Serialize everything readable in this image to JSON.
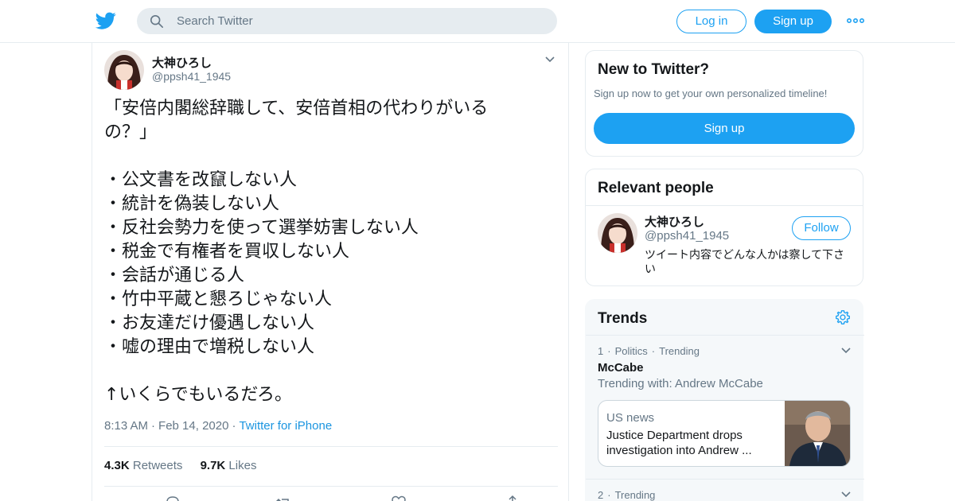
{
  "header": {
    "search_placeholder": "Search Twitter",
    "login_label": "Log in",
    "signup_label": "Sign up",
    "brand_color": "#1da1f2"
  },
  "tweet": {
    "author_name": "大神ひろし",
    "author_handle": "@ppsh41_1945",
    "lines": [
      "「安倍内閣総辞職して、安倍首相の代わりがいる",
      "の？」",
      "",
      "・公文書を改竄しない人",
      "・統計を偽装しない人",
      "・反社会勢力を使って選挙妨害しない人",
      "・税金で有権者を買収しない人",
      "・会話が通じる人",
      "・竹中平蔵と懇ろじゃない人",
      "・お友達だけ優遇しない人",
      "・嘘の理由で増税しない人",
      "",
      "↑いくらでもいるだろ。"
    ],
    "time": "8:13 AM",
    "date": "Feb 14, 2020",
    "source": "Twitter for iPhone",
    "retweets_count": "4.3K",
    "retweets_label": "Retweets",
    "likes_count": "9.7K",
    "likes_label": "Likes"
  },
  "sidebar": {
    "new_to_twitter": {
      "title": "New to Twitter?",
      "subtitle": "Sign up now to get your own personalized timeline!",
      "button": "Sign up"
    },
    "relevant_people": {
      "title": "Relevant people",
      "name": "大神ひろし",
      "handle": "@ppsh41_1945",
      "bio": "ツイート内容でどんな人かは察して下さい",
      "follow_label": "Follow"
    },
    "trends": {
      "title": "Trends",
      "items": [
        {
          "rank": "1",
          "category": "Politics",
          "status": "Trending",
          "name": "McCabe",
          "with": "Trending with: Andrew McCabe",
          "news_source": "US news",
          "news_headline": "Justice Department drops investigation into Andrew ..."
        },
        {
          "rank": "2",
          "status": "Trending"
        }
      ]
    }
  }
}
